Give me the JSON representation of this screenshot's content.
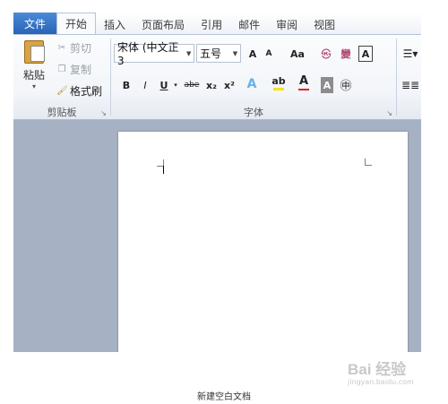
{
  "tabs": {
    "file": "文件",
    "home": "开始",
    "insert": "插入",
    "layout": "页面布局",
    "references": "引用",
    "mailings": "邮件",
    "review": "审阅",
    "view": "视图"
  },
  "clipboard": {
    "paste": "粘贴",
    "cut": "剪切",
    "copy": "复制",
    "format_painter": "格式刷",
    "group_label": "剪贴板"
  },
  "font": {
    "font_name": "宋体 (中文正3",
    "font_size": "五号",
    "grow": "A",
    "shrink": "A",
    "change_case": "Aa",
    "clear": "㉿",
    "pinyin": "變",
    "border": "A",
    "bold": "B",
    "italic": "I",
    "underline": "U",
    "strike": "abe",
    "subscript": "x₂",
    "superscript": "x²",
    "text_effect": "A",
    "highlight": "ab",
    "font_color": "A",
    "shading": "A",
    "enclose": "㊥",
    "group_label": "字体"
  },
  "colors": {
    "accent_blue": "#2a64b8",
    "highlight_yellow": "#f5e400",
    "font_red": "#e02020",
    "workspace": "#a6b1c3"
  },
  "caption": "新建空白文档",
  "watermark": {
    "text": "Bai 经验",
    "sub": "jingyan.baidu.com"
  }
}
